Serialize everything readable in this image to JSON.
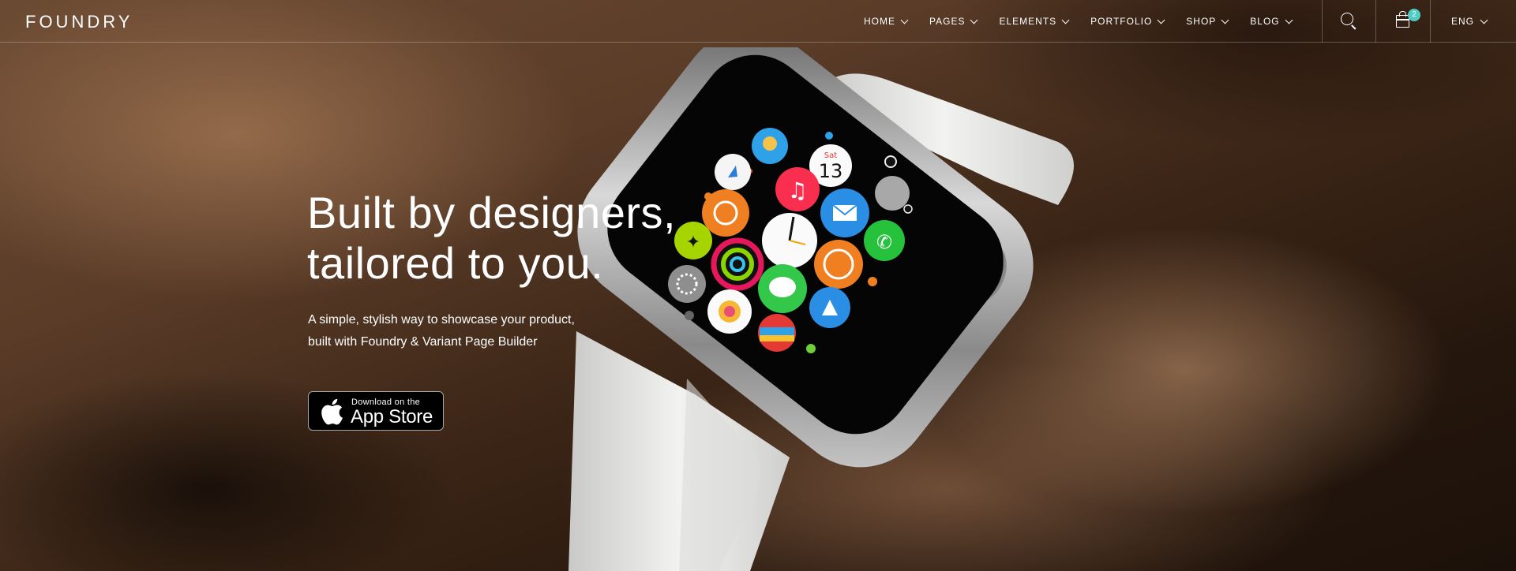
{
  "brand": {
    "logo": "FOUNDRY"
  },
  "nav": {
    "items": [
      {
        "label": "HOME"
      },
      {
        "label": "PAGES"
      },
      {
        "label": "ELEMENTS"
      },
      {
        "label": "PORTFOLIO"
      },
      {
        "label": "SHOP"
      },
      {
        "label": "BLOG"
      }
    ],
    "search_icon": "search-icon",
    "cart_icon": "shopping-bag-icon",
    "cart_count": "2",
    "language": "ENG"
  },
  "hero": {
    "headline_line1": "Built by designers,",
    "headline_line2": "tailored to you.",
    "subtext_line1": "A simple, stylish way to showcase your product,",
    "subtext_line2": "built with Foundry & Variant Page Builder",
    "appstore_small": "Download on the",
    "appstore_big": "App Store",
    "watch_date_day": "Sat",
    "watch_date_num": "13"
  },
  "colors": {
    "accent": "#4ecdc4",
    "text": "#ffffff",
    "band": "#e8e8e6"
  }
}
